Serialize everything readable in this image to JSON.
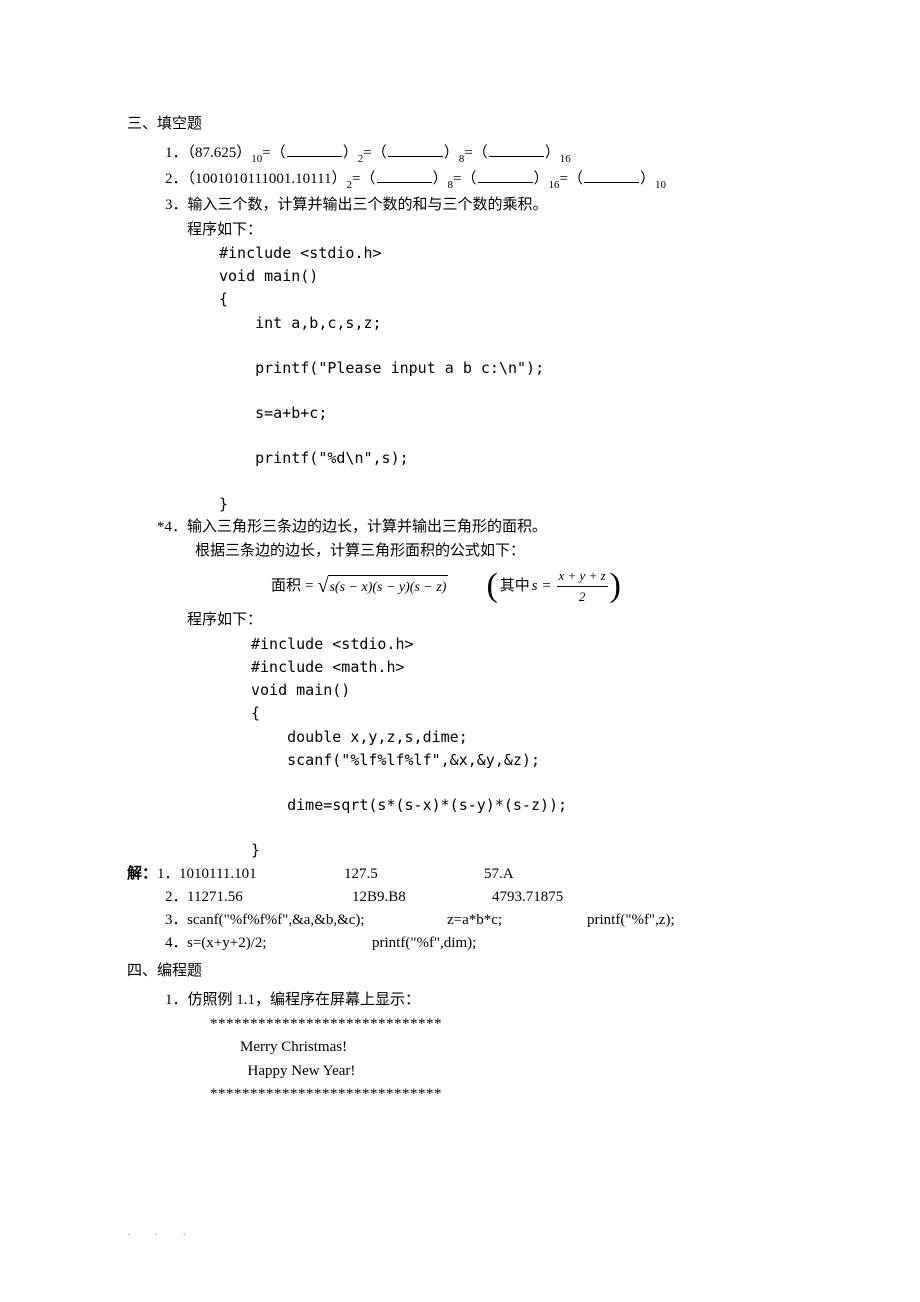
{
  "sec3": {
    "title": "三、填空题",
    "q1": {
      "num": "1．",
      "base_val": "（87.625）",
      "sub10": "10",
      "eq_open": "=（",
      "close_eq": "）",
      "sub2": "2",
      "sub8": "8",
      "sub16": "16"
    },
    "q2": {
      "num": "2．",
      "base_val": "（1001010111001.10111）",
      "sub2": "2",
      "eq_open": "=（",
      "close_eq": "）",
      "sub8": "8",
      "sub16": "16",
      "sub10": "10"
    },
    "q3": {
      "num": "3．",
      "text": "输入三个数，计算并输出三个数的和与三个数的乘积。",
      "prog_label": "程序如下：",
      "code": [
        "#include <stdio.h>",
        "void main()",
        "{",
        "    int a,b,c,s,z;",
        "",
        "    printf(\"Please input a b c:\\n\");",
        "",
        "    s=a+b+c;",
        "",
        "    printf(\"%d\\n\",s);",
        "",
        "}"
      ]
    },
    "q4": {
      "num": "*4．",
      "text": "输入三角形三条边的边长，计算并输出三角形的面积。",
      "note": "根据三条边的边长，计算三角形面积的公式如下：",
      "formula_lhs": "面积",
      "formula_eq": "=",
      "sqrt_body": "s(s − x)(s − y)(s − z)",
      "paren_label": "其中 ",
      "s_eq": "s =",
      "frac_num": "x + y + z",
      "frac_den": "2",
      "prog_label": "程序如下：",
      "code": [
        "#include <stdio.h>",
        "#include <math.h>",
        "void main()",
        "{",
        "    double x,y,z,s,dime;",
        "    scanf(\"%lf%lf%lf\",&x,&y,&z);",
        "",
        "    dime=sqrt(s*(s-x)*(s-y)*(s-z));",
        "",
        "}"
      ]
    },
    "answers": {
      "label": "解：",
      "lines": [
        {
          "n": "1．",
          "a": "1010111.101",
          "b": "127.5",
          "c": "57.A"
        },
        {
          "n": "2．",
          "a": "11271.56",
          "b": "12B9.B8",
          "c": "4793.71875"
        }
      ],
      "line3": {
        "n": "3．",
        "a": "scanf(\"%f%f%f\",&a,&b,&c);",
        "b": "z=a*b*c;",
        "c": "printf(\"%f\",z);"
      },
      "line4": {
        "n": "4．",
        "a": "s=(x+y+2)/2;",
        "b": "printf(\"%f\",dim);"
      }
    }
  },
  "sec4": {
    "title": "四、编程题",
    "q1": {
      "num": "1．",
      "text": "仿照例 1.1，编程序在屏幕上显示：",
      "out": [
        "*****************************",
        "        Merry Christmas!",
        "          Happy New Year!",
        "*****************************"
      ]
    }
  },
  "footer": "···"
}
